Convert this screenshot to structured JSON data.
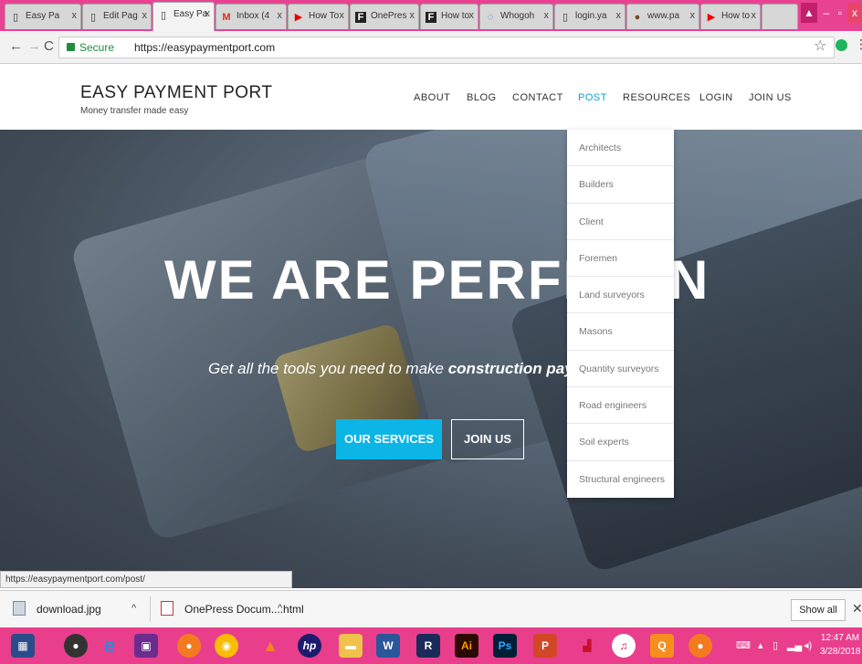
{
  "browser": {
    "tabs": [
      {
        "label": "Easy Pa",
        "icon": "page-icon"
      },
      {
        "label": "Edit Pag",
        "icon": "page-icon"
      },
      {
        "label": "Easy Pa",
        "icon": "page-icon",
        "active": true
      },
      {
        "label": "Inbox (4",
        "icon": "gmail-icon"
      },
      {
        "label": "How To",
        "icon": "youtube-icon"
      },
      {
        "label": "OnePres",
        "icon": "onepress-icon"
      },
      {
        "label": "How to",
        "icon": "onepress-icon"
      },
      {
        "label": "Whogoh",
        "icon": "loading-icon"
      },
      {
        "label": "login.ya",
        "icon": "page-icon"
      },
      {
        "label": "www.pa",
        "icon": "bird-icon"
      },
      {
        "label": "How to",
        "icon": "youtube-icon"
      }
    ],
    "address": {
      "secure_label": "Secure",
      "url": "https://easypaymentport.com"
    }
  },
  "site": {
    "logo_title": "EASY PAYMENT PORT",
    "logo_subtitle": "Money transfer made easy",
    "nav": [
      "ABOUT",
      "BLOG",
      "CONTACT",
      "POST",
      "RESOURCES",
      "LOGIN",
      "JOIN US"
    ],
    "active_nav": "POST",
    "hero": {
      "title": "WE ARE PERFEC",
      "title_tail": "N",
      "subtitle_prefix": "Get all the tools you need to make ",
      "subtitle_bold": "construction payments",
      "btn_services": "OUR SERVICES",
      "btn_join": "JOIN US"
    },
    "post_dropdown": [
      "Architects",
      "Builders",
      "Client",
      "Foremen",
      "Land surveyors",
      "Masons",
      "Quantity surveyors",
      "Road engineers",
      "Soil experts",
      "Structural engineers"
    ]
  },
  "status_url": "https://easypaymentport.com/post/",
  "downloads": {
    "items": [
      {
        "name": "download.jpg"
      },
      {
        "name": "OnePress Docum....html"
      }
    ],
    "show_all": "Show all"
  },
  "taskbar": {
    "clock_time": "12:47 AM",
    "clock_date": "3/28/2018"
  },
  "colors": {
    "accent": "#0bb5e6",
    "taskbar": "#e83e8c"
  }
}
